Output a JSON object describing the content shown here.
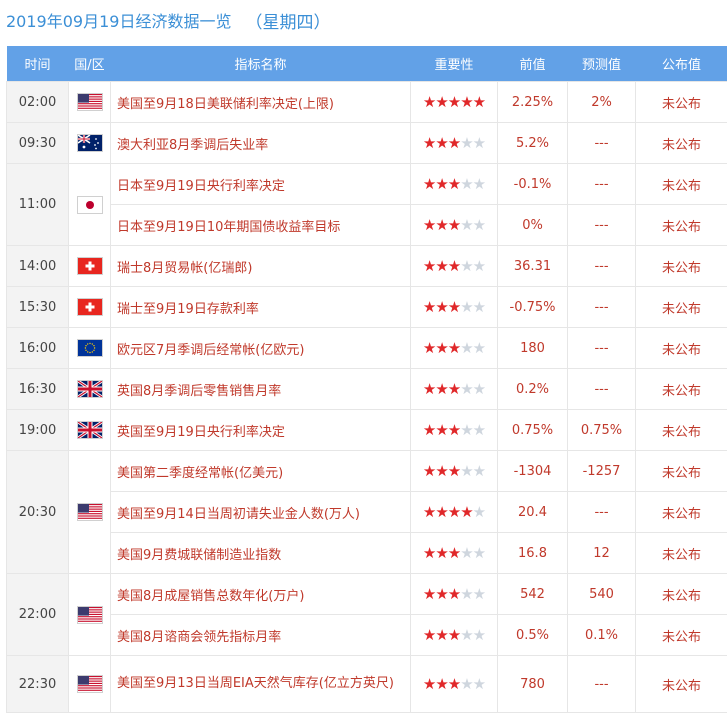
{
  "header": {
    "date": "2019年09月19日经济数据一览",
    "weekday": "（星期四）"
  },
  "columns": [
    "时间",
    "国/区",
    "指标名称",
    "重要性",
    "前值",
    "预测值",
    "公布值"
  ],
  "colors": {
    "header_bg": "#62a1e7",
    "title_text": "#3b8fd6",
    "value_text": "#c0392b",
    "star_on": "#e0282a",
    "star_off": "#cfd6de"
  },
  "groups": [
    {
      "time": "02:00",
      "flag": "us-flag-icon",
      "rows": [
        {
          "name": "美国至9月18日美联储利率决定(上限)",
          "stars": 5,
          "prev": "2.25%",
          "forecast": "2%",
          "actual": "未公布"
        }
      ]
    },
    {
      "time": "09:30",
      "flag": "au-flag-icon",
      "rows": [
        {
          "name": "澳大利亚8月季调后失业率",
          "stars": 3,
          "prev": "5.2%",
          "forecast": "---",
          "actual": "未公布"
        }
      ]
    },
    {
      "time": "11:00",
      "flag": "jp-flag-icon",
      "rows": [
        {
          "name": "日本至9月19日央行利率决定",
          "stars": 3,
          "prev": "-0.1%",
          "forecast": "---",
          "actual": "未公布"
        },
        {
          "name": "日本至9月19日10年期国债收益率目标",
          "stars": 3,
          "prev": "0%",
          "forecast": "---",
          "actual": "未公布"
        }
      ]
    },
    {
      "time": "14:00",
      "flag": "ch-flag-icon",
      "rows": [
        {
          "name": "瑞士8月贸易帐(亿瑞郎)",
          "stars": 3,
          "prev": "36.31",
          "forecast": "---",
          "actual": "未公布"
        }
      ]
    },
    {
      "time": "15:30",
      "flag": "ch-flag-icon",
      "rows": [
        {
          "name": "瑞士至9月19日存款利率",
          "stars": 3,
          "prev": "-0.75%",
          "forecast": "---",
          "actual": "未公布"
        }
      ]
    },
    {
      "time": "16:00",
      "flag": "eu-flag-icon",
      "rows": [
        {
          "name": "欧元区7月季调后经常帐(亿欧元)",
          "stars": 3,
          "prev": "180",
          "forecast": "---",
          "actual": "未公布"
        }
      ]
    },
    {
      "time": "16:30",
      "flag": "uk-flag-icon",
      "rows": [
        {
          "name": "英国8月季调后零售销售月率",
          "stars": 3,
          "prev": "0.2%",
          "forecast": "---",
          "actual": "未公布"
        }
      ]
    },
    {
      "time": "19:00",
      "flag": "uk-flag-icon",
      "rows": [
        {
          "name": "英国至9月19日央行利率决定",
          "stars": 3,
          "prev": "0.75%",
          "forecast": "0.75%",
          "actual": "未公布"
        }
      ]
    },
    {
      "time": "20:30",
      "flag": "us-flag-icon",
      "rows": [
        {
          "name": "美国第二季度经常帐(亿美元)",
          "stars": 3,
          "prev": "-1304",
          "forecast": "-1257",
          "actual": "未公布"
        },
        {
          "name": "美国至9月14日当周初请失业金人数(万人)",
          "stars": 4,
          "prev": "20.4",
          "forecast": "---",
          "actual": "未公布"
        },
        {
          "name": "美国9月费城联储制造业指数",
          "stars": 3,
          "prev": "16.8",
          "forecast": "12",
          "actual": "未公布"
        }
      ]
    },
    {
      "time": "22:00",
      "flag": "us-flag-icon",
      "rows": [
        {
          "name": "美国8月成屋销售总数年化(万户)",
          "stars": 3,
          "prev": "542",
          "forecast": "540",
          "actual": "未公布"
        },
        {
          "name": "美国8月谘商会领先指标月率",
          "stars": 3,
          "prev": "0.5%",
          "forecast": "0.1%",
          "actual": "未公布"
        }
      ]
    },
    {
      "time": "22:30",
      "flag": "us-flag-icon",
      "rows": [
        {
          "name": "美国至9月13日当周EIA天然气库存(亿立方英尺)",
          "stars": 3,
          "prev": "780",
          "forecast": "---",
          "actual": "未公布"
        }
      ]
    }
  ]
}
